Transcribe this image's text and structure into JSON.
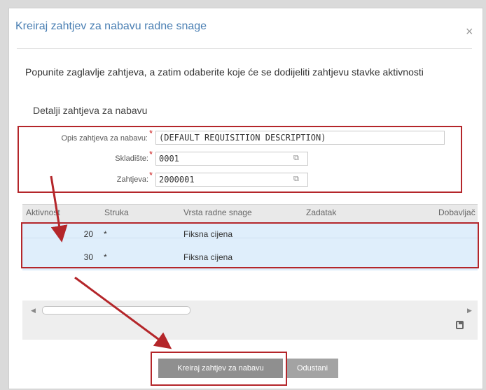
{
  "dialog": {
    "title": "Kreiraj zahtjev za nabavu radne snage",
    "close_glyph": "×",
    "instruction": "Popunite zaglavlje zahtjeva, a zatim odaberite koje će se dodijeliti zahtjevu stavke aktivnosti",
    "section_title": "Detalji zahtjeva za nabavu"
  },
  "form": {
    "description_label": "Opis zahtjeva za nabavu:",
    "description_value": "(DEFAULT REQUISITION DESCRIPTION)",
    "warehouse_label": "Skladište:",
    "warehouse_value": "0001",
    "requestor_label": "Zahtjeva:",
    "requestor_value": "2000001",
    "required_mark": "*",
    "lookup_icon": "lookup-icon"
  },
  "grid": {
    "columns": [
      "Aktivnost",
      "Struka",
      "Vrsta radne snage",
      "Zadatak",
      "Dobavljač"
    ],
    "rows": [
      {
        "aktivnost": "20",
        "struka": "*",
        "vrsta": "Fiksna cijena"
      },
      {
        "aktivnost": "30",
        "struka": "*",
        "vrsta": "Fiksna cijena"
      }
    ],
    "save_icon": "save-icon"
  },
  "actions": {
    "primary_label": "Kreiraj zahtjev za nabavu",
    "cancel_label": "Odustani"
  },
  "colors": {
    "title": "#4a7fb3",
    "highlight": "#b4262a",
    "selected_rows": "#dfeefb",
    "button": "#8f8f8f"
  }
}
